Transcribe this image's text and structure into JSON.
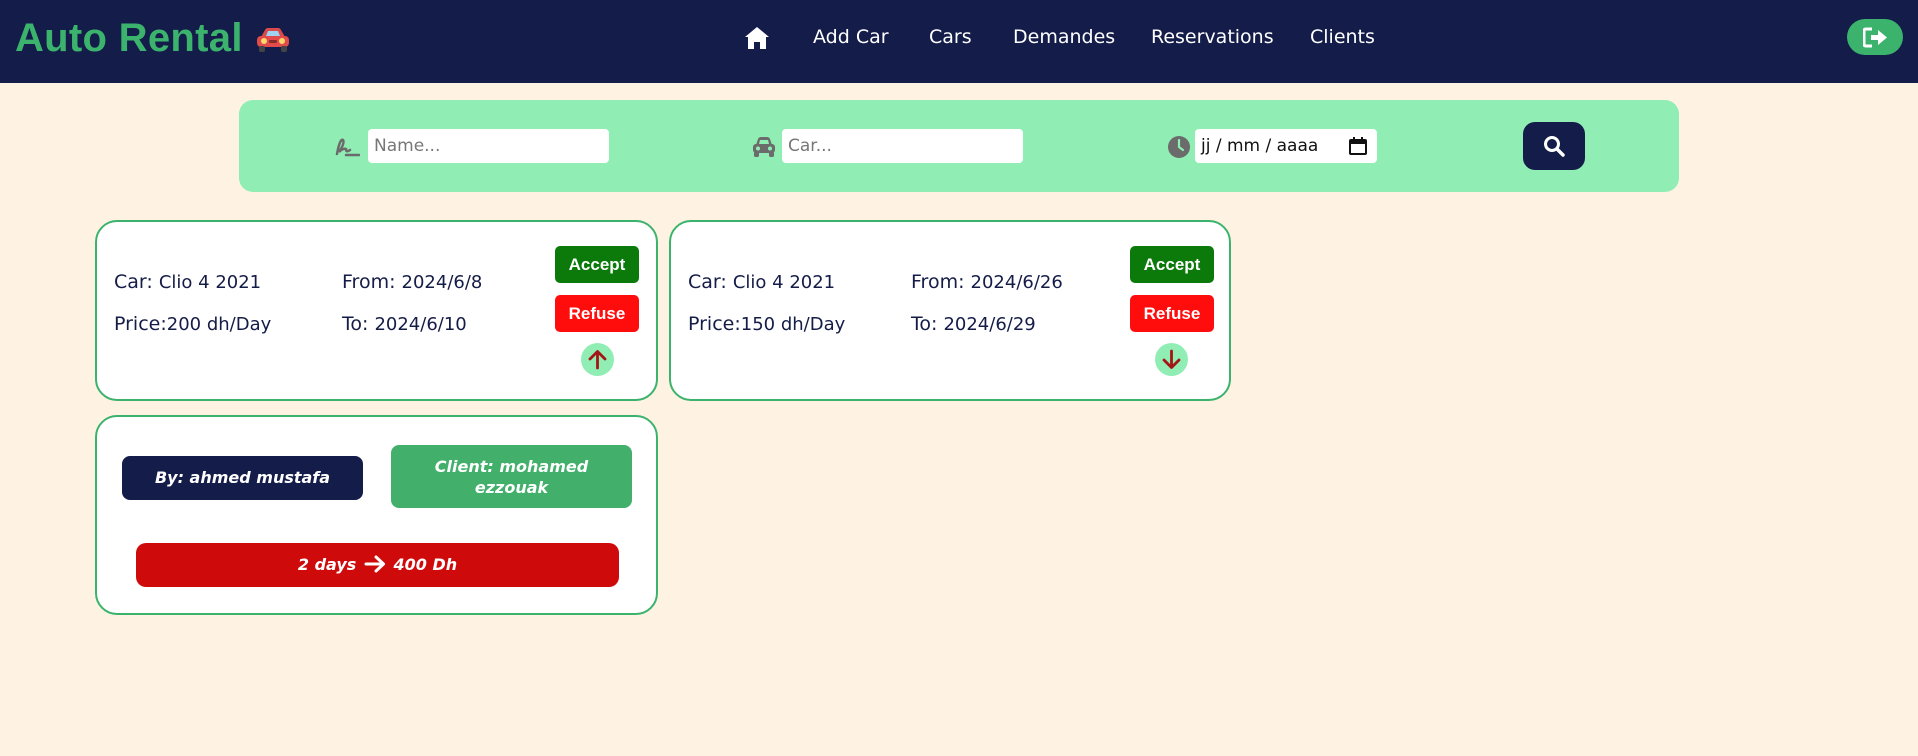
{
  "navbar": {
    "brand": "Auto Rental",
    "brand_icon": "car-emoji",
    "home_icon": "home-icon",
    "links": [
      "Add Car",
      "Cars",
      "Demandes",
      "Reservations",
      "Clients"
    ],
    "logout_icon": "sign-out-icon",
    "colors": {
      "background": "#141c4a",
      "brand": "#3bb36c"
    }
  },
  "search": {
    "name_placeholder": "Name...",
    "car_placeholder": "Car...",
    "date_placeholder": "jj / mm / aaaa",
    "name_icon": "signature-icon",
    "car_icon": "car-icon",
    "date_icon": "clock-icon",
    "button_icon": "search-icon"
  },
  "demandes": [
    {
      "car_label": "Car:",
      "car": "Clio 4 2021",
      "price_label": "Price:",
      "price": "200 dh/Day",
      "from_label": "From:",
      "from": "2024/6/8",
      "to_label": "To:",
      "to": "2024/6/10",
      "accept": "Accept",
      "refuse": "Refuse",
      "toggle_icon": "arrow-up-icon",
      "expanded": true,
      "details": {
        "by": "By: ahmed mustafa",
        "client": "Client: mohamed ezzouak",
        "total": "2 days",
        "total_amount": "400 Dh",
        "total_icon": "arrow-right-icon"
      }
    },
    {
      "car_label": "Car:",
      "car": "Clio 4 2021",
      "price_label": "Price:",
      "price": "150 dh/Day",
      "from_label": "From:",
      "from": "2024/6/26",
      "to_label": "To:",
      "to": "2024/6/29",
      "accept": "Accept",
      "refuse": "Refuse",
      "toggle_icon": "arrow-down-icon",
      "expanded": false
    }
  ],
  "colors": {
    "page_bg": "#fef3e2",
    "accent_green": "#3bb36c",
    "search_bg": "#90edb4",
    "accept": "#0b7a0b",
    "refuse": "#ff0d0d",
    "total_bg": "#cf0a0a"
  }
}
